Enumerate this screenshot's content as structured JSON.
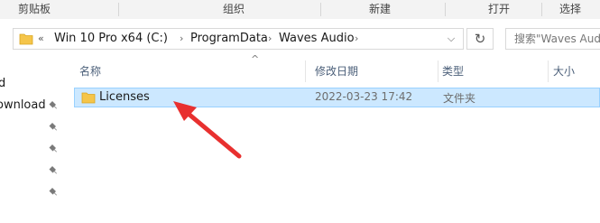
{
  "ribbon": {
    "groups": [
      "剪贴板",
      "组织",
      "新建",
      "打开",
      "选择"
    ]
  },
  "address": {
    "overflow": "«",
    "crumbs": [
      "Win 10 Pro x64 (C:)",
      "ProgramData",
      "Waves Audio"
    ],
    "separator": "›",
    "dropdown": "⌵",
    "refresh": "↻"
  },
  "search": {
    "placeholder": "搜索\"Waves Audio\""
  },
  "nav": {
    "item_top": "d",
    "item_download": "ownload"
  },
  "columns": {
    "name": "名称",
    "modified": "修改日期",
    "type": "类型",
    "size": "大小",
    "sort_caret": "^"
  },
  "files": [
    {
      "name": "Licenses",
      "modified": "2022-03-23 17:42",
      "type": "文件夹"
    }
  ],
  "colors": {
    "selection": "#cce8ff",
    "selection_border": "#99d1ff",
    "folder": "#f5c54a",
    "annotation_arrow": "#e8302f"
  }
}
